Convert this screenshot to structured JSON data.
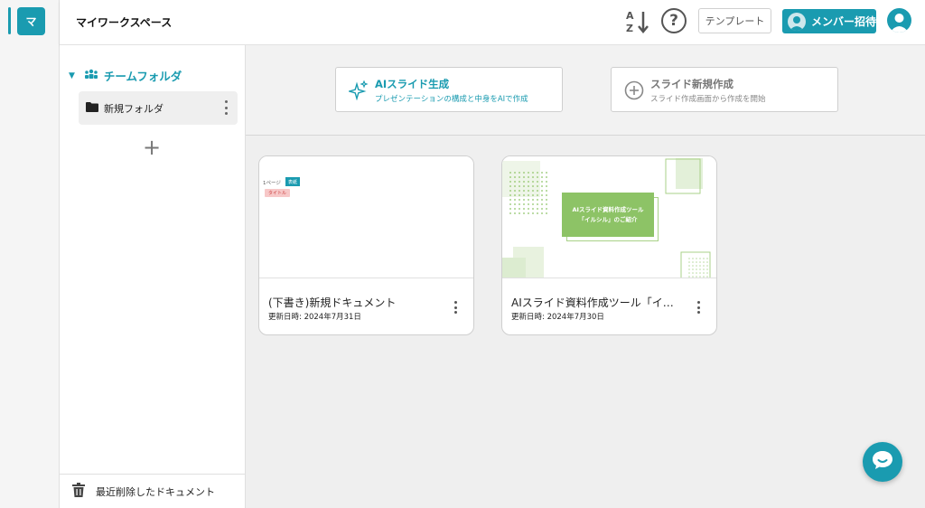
{
  "workspace": {
    "badge": "マ",
    "title": "マイワークスペース"
  },
  "header": {
    "template_label": "テンプレート",
    "invite_label": "メンバー招待",
    "help_label": "?"
  },
  "sidebar": {
    "team_folder_label": "チームフォルダ",
    "folders": [
      {
        "label": "新規フォルダ"
      }
    ],
    "add_label": "+",
    "trash_label": "最近削除したドキュメント"
  },
  "actions": {
    "ai": {
      "title": "AIスライド生成",
      "subtitle": "プレゼンテーションの構成と中身をAIで作成"
    },
    "new": {
      "title": "スライド新規作成",
      "subtitle": "スライド作成画面から作成を開始"
    }
  },
  "documents": [
    {
      "title": "(下書き)新規ドキュメント",
      "date": "更新日時: 2024年7月31日",
      "thumb": {
        "page": "1ページ",
        "tag": "表紙",
        "title_tag": "タイトル"
      }
    },
    {
      "title": "AIスライド資料作成ツール「イ…",
      "date": "更新日時: 2024年7月30日",
      "thumb": {
        "slide_text": "AIスライド資料作成ツール「イルシル」のご紹介"
      }
    }
  ],
  "colors": {
    "accent": "#1a9bb0",
    "slide_green": "#8dc366"
  }
}
